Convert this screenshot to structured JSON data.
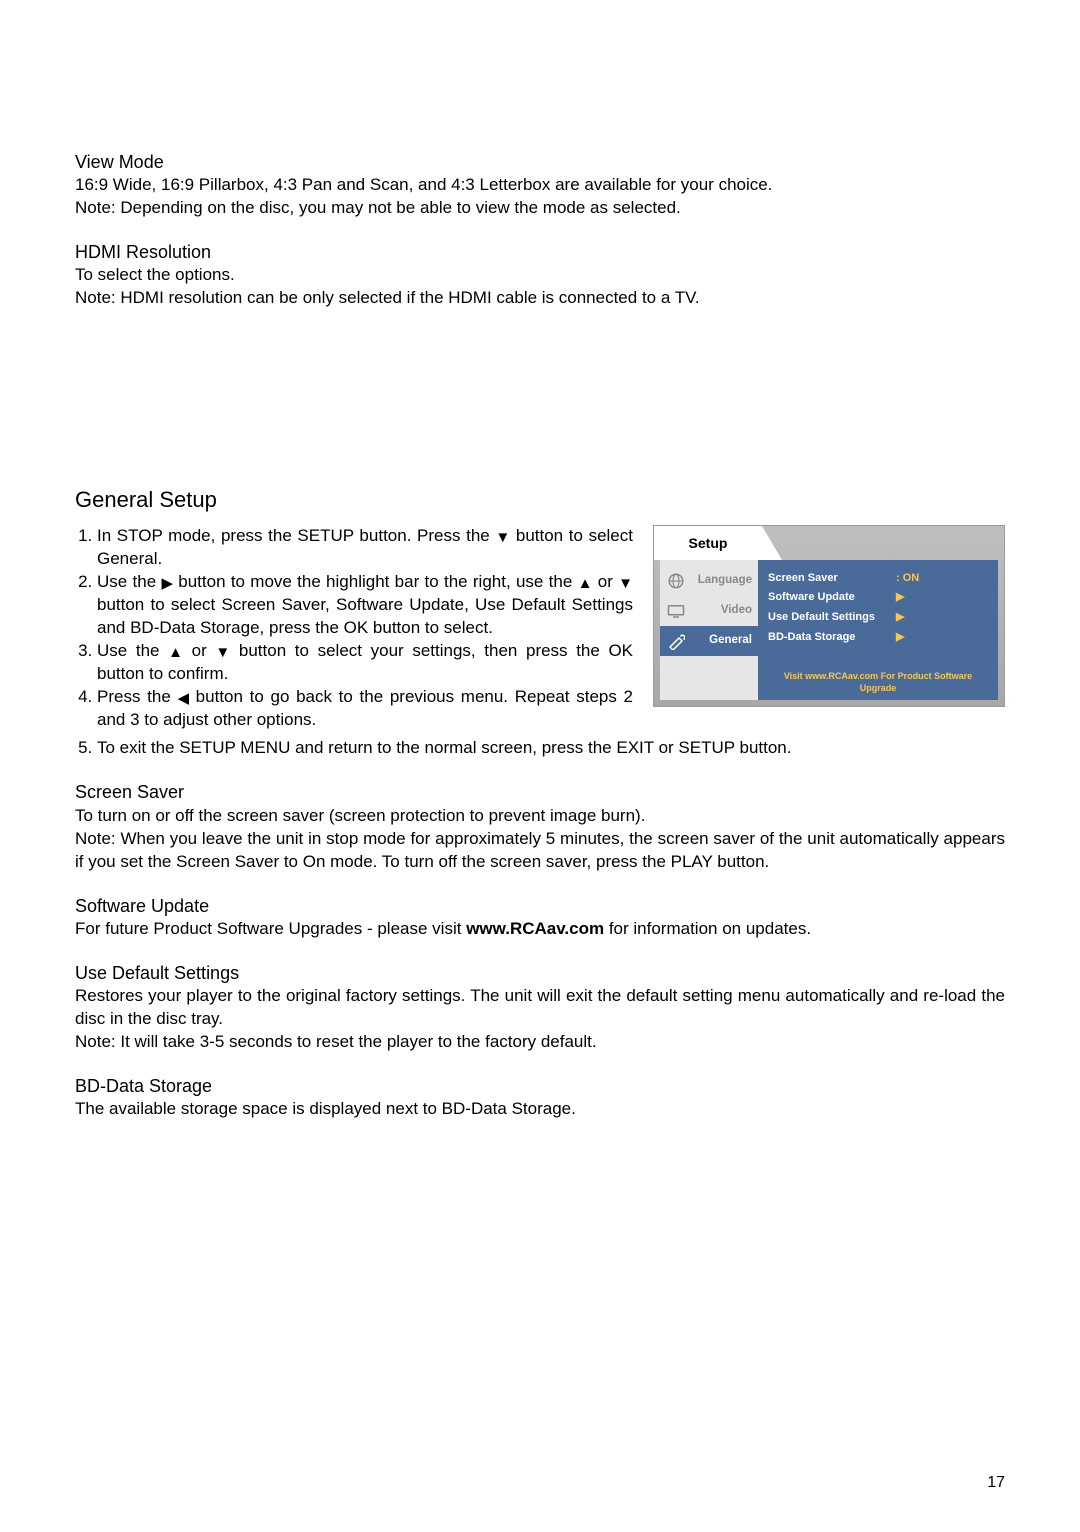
{
  "view_mode": {
    "heading": "View Mode",
    "line1": "16:9 Wide, 16:9 Pillarbox, 4:3 Pan and Scan, and 4:3 Letterbox are available for your choice.",
    "line2": "Note: Depending on the disc, you may not be able to view the mode as selected."
  },
  "hdmi_resolution": {
    "heading": "HDMI Resolution",
    "line1": "To select the options.",
    "line2": "Note: HDMI resolution can be only selected if the HDMI cable is connected to a TV."
  },
  "general_setup": {
    "heading": "General Setup",
    "steps": {
      "s1_a": "In STOP mode, press the SETUP button. Press the ",
      "s1_b": " button to select General.",
      "s2_a": "Use the ",
      "s2_b": " button to move the highlight bar to the right, use the ",
      "s2_c": " or ",
      "s2_d": " button to select Screen Saver, Software Update, Use Default Settings and BD-Data Storage, press the OK button to select.",
      "s3_a": "Use the ",
      "s3_b": " or ",
      "s3_c": " button to select your settings, then press the OK button to confirm.",
      "s4_a": "Press the ",
      "s4_b": " button to go back to the previous menu. Repeat steps 2 and 3 to adjust other options.",
      "s5": "To exit the SETUP MENU and return to the normal screen, press the EXIT or SETUP button."
    }
  },
  "setup_menu": {
    "title": "Setup",
    "left_items": [
      {
        "label": "Language",
        "icon": "globe-icon"
      },
      {
        "label": "Video",
        "icon": "tv-icon"
      },
      {
        "label": "General",
        "icon": "gear-icon"
      }
    ],
    "right_items": [
      {
        "label": "Screen Saver",
        "value": ":  ON"
      },
      {
        "label": "Software Update",
        "value": "▶"
      },
      {
        "label": "Use Default Settings",
        "value": "▶"
      },
      {
        "label": "BD-Data Storage",
        "value": "▶"
      }
    ],
    "footnote": "Visit www.RCAav.com For Product Software Upgrade"
  },
  "screen_saver": {
    "heading": "Screen Saver",
    "line1": "To turn on or off the screen saver (screen protection to prevent image burn).",
    "line2": "Note: When you leave the unit in stop mode for approximately 5 minutes, the screen saver of the unit automatically appears if you set the Screen Saver to On mode. To turn off the screen saver, press the PLAY button."
  },
  "software_update": {
    "heading": "Software Update",
    "prefix": "For future Product Software Upgrades - please visit ",
    "link": "www.RCAav.com",
    "suffix": " for information on updates."
  },
  "use_default": {
    "heading": "Use Default Settings",
    "line1": "Restores your player to the original factory settings. The unit will exit the default setting menu automatically and re-load the disc in the disc tray.",
    "line2": "Note:  It will take 3-5 seconds to reset the player to the factory default."
  },
  "bd_data": {
    "heading": "BD-Data Storage",
    "line1": "The available storage space is displayed next to BD-Data Storage."
  },
  "page_number": "17",
  "triangles": {
    "down": "▼",
    "up": "▲",
    "right": "▶",
    "left": "◀"
  }
}
